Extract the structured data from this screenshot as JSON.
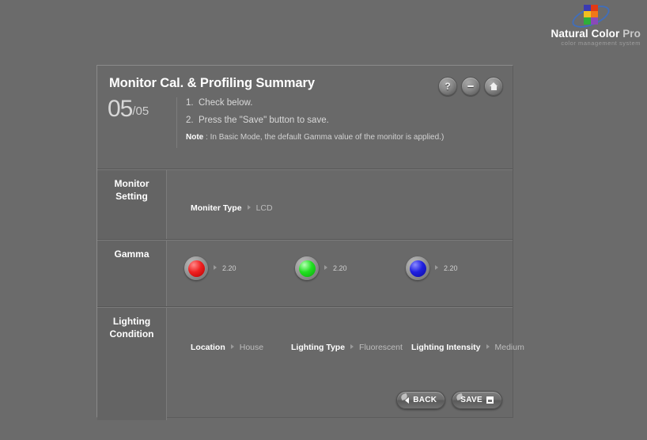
{
  "brand": {
    "name_main": "Natural Color",
    "name_pro": "Pro",
    "tagline": "color management system",
    "logo_icon": "natural-color-pro-logo"
  },
  "panel": {
    "title": "Monitor Cal. & Profiling Summary",
    "step_current": "05",
    "step_total": "/05",
    "instructions": [
      {
        "num": "1.",
        "text": "Check below."
      },
      {
        "num": "2.",
        "text": "Press the \"Save\" button to save."
      }
    ],
    "note_label": "Note",
    "note_text": " : In Basic Mode, the default Gamma value of the monitor is applied.)",
    "window_buttons": [
      {
        "name": "help-button",
        "icon": "question-mark-icon",
        "label": "?"
      },
      {
        "name": "minimize-button",
        "icon": "minus-icon",
        "label": "-"
      },
      {
        "name": "home-button",
        "icon": "home-icon",
        "label": ""
      }
    ]
  },
  "sections": {
    "monitor": {
      "label_line1": "Monitor",
      "label_line2": "Setting",
      "fields": [
        {
          "label": "Moniter Type",
          "value": "LCD"
        }
      ]
    },
    "gamma": {
      "label_line1": "Gamma",
      "label_line2": "",
      "channels": [
        {
          "name": "red",
          "color": "#e01010",
          "value": "2.20"
        },
        {
          "name": "green",
          "color": "#12e012",
          "value": "2.20"
        },
        {
          "name": "blue",
          "color": "#1a1ad8",
          "value": "2.20"
        }
      ]
    },
    "lighting": {
      "label_line1": "Lighting",
      "label_line2": "Condition",
      "fields": [
        {
          "label": "Location",
          "value": "House"
        },
        {
          "label": "Lighting Type",
          "value": "Fluorescent"
        },
        {
          "label": "Lighting Intensity",
          "value": "Medium"
        }
      ]
    }
  },
  "buttons": {
    "back": "BACK",
    "save": "SAVE"
  }
}
